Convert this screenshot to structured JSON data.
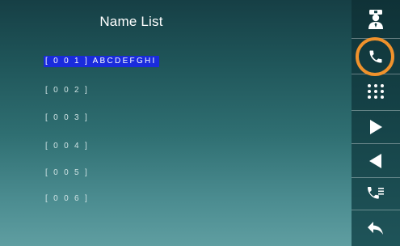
{
  "title": "Name List",
  "entries": [
    {
      "label": "[ 0 0 1 ] ABCDEFGHI",
      "selected": true
    },
    {
      "label": "[ 0 0 2 ]",
      "selected": false
    },
    {
      "label": "[ 0 0 3 ]",
      "selected": false
    },
    {
      "label": "[ 0 0 4 ]",
      "selected": false
    },
    {
      "label": "[ 0 0 5 ]",
      "selected": false
    },
    {
      "label": "[ 0 0 6 ]",
      "selected": false
    }
  ],
  "sidebar": {
    "buttons": [
      {
        "name": "guard-icon"
      },
      {
        "name": "phone-icon"
      },
      {
        "name": "keypad-icon"
      },
      {
        "name": "play-right-icon"
      },
      {
        "name": "play-left-icon"
      },
      {
        "name": "call-list-icon"
      },
      {
        "name": "back-icon"
      }
    ]
  },
  "colors": {
    "selection": "#1a2bdc",
    "highlight_ring": "#f0922c",
    "text": "#ffffff"
  }
}
